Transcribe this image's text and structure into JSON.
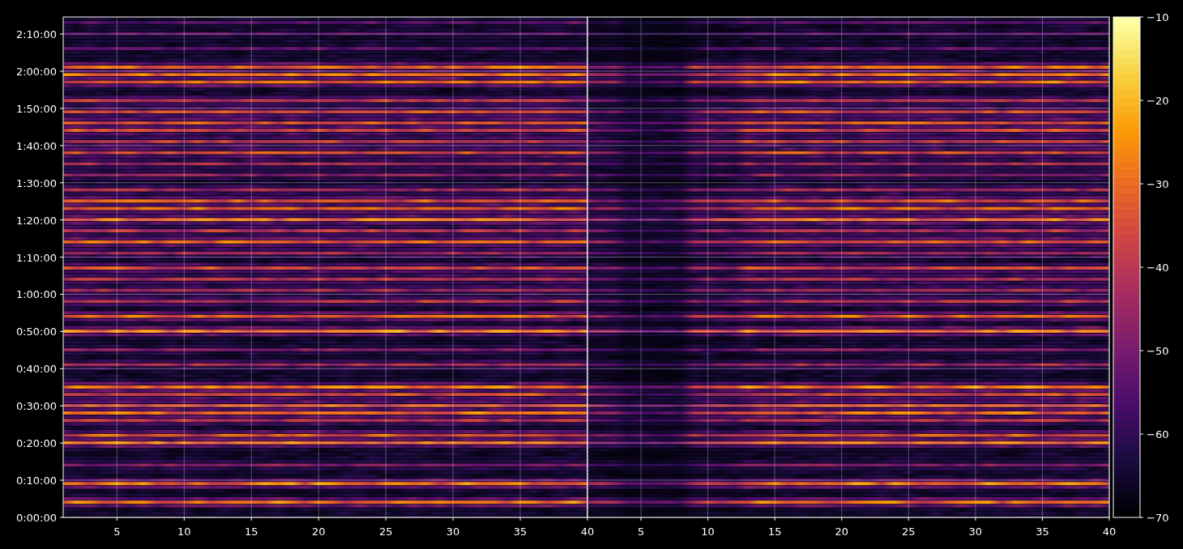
{
  "figure": {
    "y_axis": {
      "ticks": [
        "2:10:00",
        "2:00:00",
        "1:50:00",
        "1:40:00",
        "1:30:00",
        "1:20:00",
        "1:10:00",
        "1:00:00",
        "0:50:00",
        "0:40:00",
        "0:30:00",
        "0:20:00",
        "0:10:00",
        "0:00:00"
      ]
    },
    "panels": [
      {
        "x_ticks": [
          "5",
          "10",
          "15",
          "20",
          "25",
          "30",
          "35",
          "40"
        ]
      },
      {
        "x_ticks": [
          "5",
          "10",
          "15",
          "20",
          "25",
          "30",
          "35",
          "40"
        ]
      }
    ],
    "colorbar": {
      "ticks": [
        "−10",
        "−20",
        "−30",
        "−40",
        "−50",
        "−60",
        "−70"
      ]
    }
  }
}
